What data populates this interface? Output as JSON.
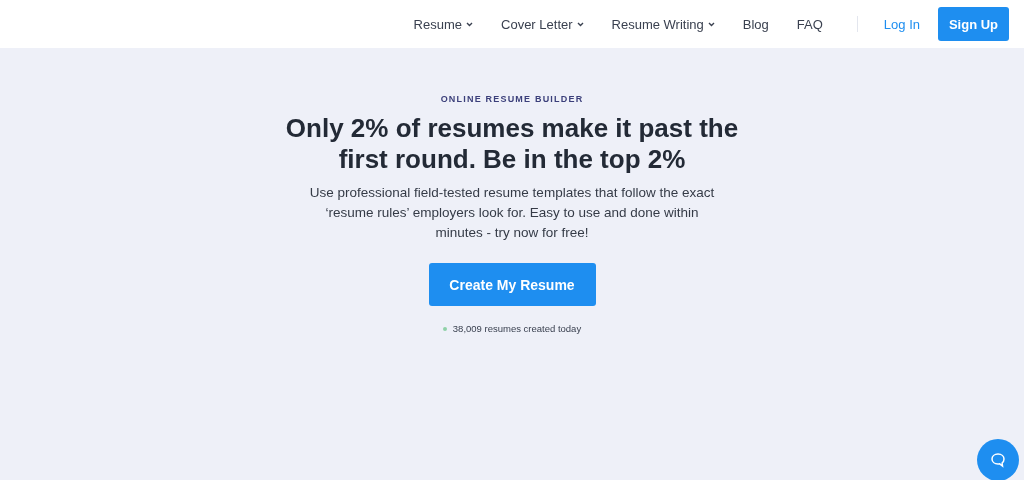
{
  "nav": {
    "items": [
      {
        "label": "Resume",
        "kind": "dropdown"
      },
      {
        "label": "Cover Letter",
        "kind": "dropdown"
      },
      {
        "label": "Resume Writing",
        "kind": "dropdown"
      },
      {
        "label": "Blog",
        "kind": "link"
      },
      {
        "label": "FAQ",
        "kind": "link"
      }
    ],
    "login": "Log In",
    "signup": "Sign Up"
  },
  "hero": {
    "eyebrow": "ONLINE RESUME BUILDER",
    "title": "Only 2% of resumes make it past the first round. Be in the top 2%",
    "subtitle": "Use professional field-tested resume templates that follow the exact ‘resume rules’ employers look for. Easy to use and done within minutes - try now for free!",
    "cta": "Create My Resume",
    "stat": "38,009 resumes created today"
  }
}
